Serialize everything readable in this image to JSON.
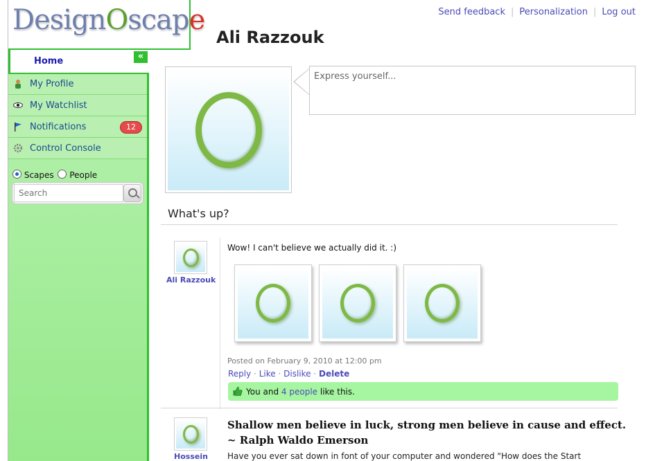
{
  "logo": {
    "part1": "Design",
    "o": "O",
    "part2": "scap",
    "e": "e"
  },
  "nav": {
    "home": "Home",
    "collapse": "«",
    "items": [
      {
        "label": "My Profile",
        "icon": "person-icon"
      },
      {
        "label": "My Watchlist",
        "icon": "eye-icon"
      },
      {
        "label": "Notifications",
        "icon": "flag-icon",
        "badge": "12"
      },
      {
        "label": "Control Console",
        "icon": "gear-icon"
      }
    ]
  },
  "search": {
    "options": [
      "Scapes",
      "People"
    ],
    "selected": "Scapes",
    "placeholder": "Search"
  },
  "toplinks": {
    "feedback": "Send feedback",
    "personalization": "Personalization",
    "logout": "Log out"
  },
  "profile": {
    "name": "Ali Razzouk"
  },
  "composer": {
    "placeholder": "Express yourself..."
  },
  "stream": {
    "heading": "What's up?"
  },
  "post1": {
    "author": "Ali Razzouk",
    "text": "Wow! I can't believe we actually did it. :)",
    "meta": "Posted on February 9, 2010 at 12:00 pm",
    "actions": {
      "reply": "Reply",
      "like": "Like",
      "dislike": "Dislike",
      "delete": "Delete",
      "sep": "·"
    },
    "likes": {
      "pre": "You and",
      "link": "4 people",
      "post": "like this."
    }
  },
  "post2": {
    "author": "Hossein",
    "quote_line1": "Shallow men believe in luck, strong men believe in cause and effect.",
    "quote_line2": "~ Ralph Waldo Emerson",
    "body": "Have you ever sat down in font of your computer and wondered \"How does the Start"
  },
  "colors": {
    "accent": "#2fbf2f",
    "sidebar": "#a8ee9f",
    "link": "#4a4ab8",
    "badge": "#e54b4b",
    "likebar": "#a6f5a0"
  }
}
